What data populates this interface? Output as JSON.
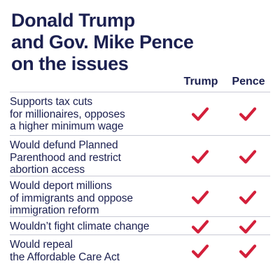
{
  "title_lines": [
    "Donald Trump",
    "and Gov. Mike Pence",
    "on the issues"
  ],
  "columns": {
    "trump": "Trump",
    "pence": "Pence"
  },
  "check_color": "#d31f3a",
  "text_color": "#1b2050",
  "icons": {
    "check": "checkmark-icon"
  },
  "rows": [
    {
      "label": "Supports tax cuts\nfor millionaires, opposes\na higher minimum wage",
      "trump": true,
      "pence": true
    },
    {
      "label": "Would defund Planned\nParenthood and restrict\nabortion access",
      "trump": true,
      "pence": true
    },
    {
      "label": "Would deport millions\nof immigrants and oppose\nimmigration reform",
      "trump": true,
      "pence": true
    },
    {
      "label": "Wouldn’t fight climate change",
      "trump": true,
      "pence": true
    },
    {
      "label": "Would repeal\nthe Affordable Care Act",
      "trump": true,
      "pence": true
    }
  ]
}
